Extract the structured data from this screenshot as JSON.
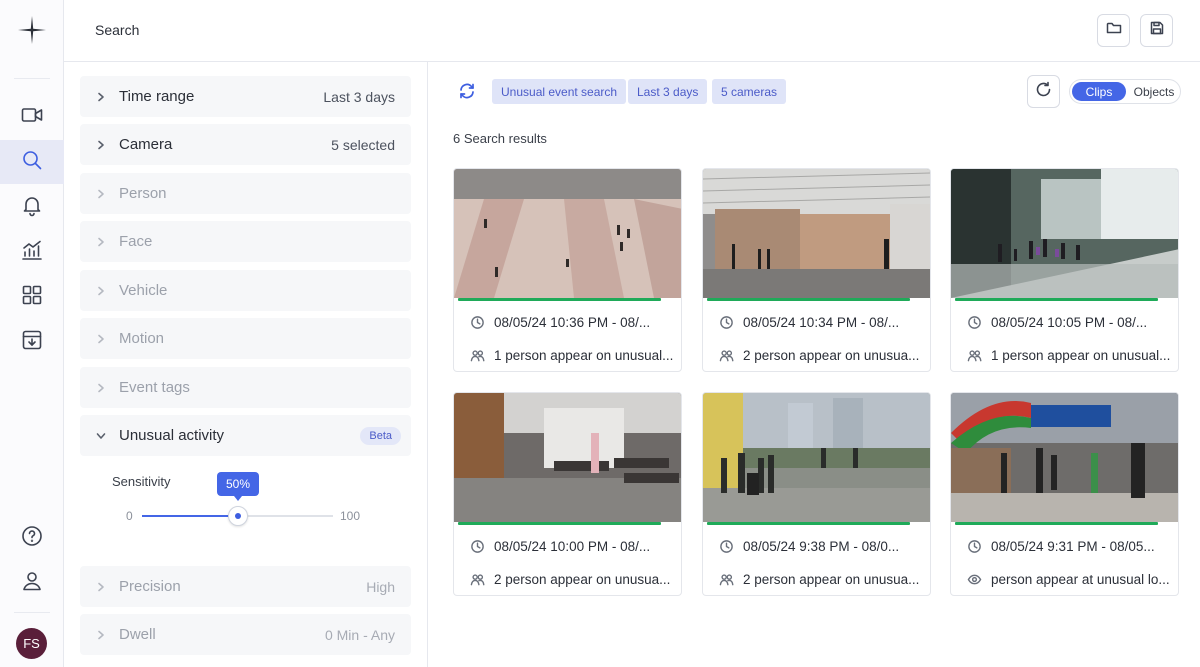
{
  "app": {
    "page_title": "Search",
    "user_initials": "FS"
  },
  "sidebar": {
    "items": [
      {
        "icon": "video-camera-icon",
        "active": false
      },
      {
        "icon": "search-icon",
        "active": true
      },
      {
        "icon": "bell-icon",
        "active": false
      },
      {
        "icon": "analytics-icon",
        "active": false
      },
      {
        "icon": "grid-icon",
        "active": false
      },
      {
        "icon": "download-icon",
        "active": false
      }
    ],
    "bottom": [
      {
        "icon": "help-icon"
      },
      {
        "icon": "user-icon"
      }
    ]
  },
  "toolbar": {
    "folder_icon": "folder-icon",
    "save_icon": "save-icon"
  },
  "filters": {
    "time_range": {
      "label": "Time range",
      "value": "Last 3 days"
    },
    "camera": {
      "label": "Camera",
      "value": "5 selected"
    },
    "person": {
      "label": "Person"
    },
    "face": {
      "label": "Face"
    },
    "vehicle": {
      "label": "Vehicle"
    },
    "motion": {
      "label": "Motion"
    },
    "event_tags": {
      "label": "Event tags"
    },
    "unusual_activity": {
      "label": "Unusual activity",
      "badge": "Beta",
      "sensitivity_label": "Sensitivity",
      "sensitivity_value": 50,
      "sensitivity_text": "50%",
      "min": "0",
      "max": "100"
    },
    "precision": {
      "label": "Precision",
      "value": "High"
    },
    "dwell": {
      "label": "Dwell",
      "value": "0 Min - Any"
    }
  },
  "results": {
    "chips": [
      "Unusual event search",
      "Last 3 days",
      "5 cameras"
    ],
    "view_toggle": {
      "clips": "Clips",
      "objects": "Objects",
      "selected": "Clips"
    },
    "count_text": "6 Search results",
    "items": [
      {
        "time": "08/05/24 10:36 PM  - 08/...",
        "desc": "1 person appear on unusual...",
        "desc_icon": "people-icon"
      },
      {
        "time": "08/05/24 10:34 PM  - 08/...",
        "desc": "2 person appear on unusua...",
        "desc_icon": "people-icon"
      },
      {
        "time": "08/05/24 10:05 PM  - 08/...",
        "desc": "1 person appear on unusual...",
        "desc_icon": "people-icon"
      },
      {
        "time": "08/05/24 10:00 PM  - 08/...",
        "desc": "2 person appear on unusua...",
        "desc_icon": "people-icon"
      },
      {
        "time": "08/05/24 9:38 PM  - 08/0...",
        "desc": "2 person appear on unusua...",
        "desc_icon": "people-icon"
      },
      {
        "time": "08/05/24 9:31 PM  - 08/05...",
        "desc": "person appear at unusual lo...",
        "desc_icon": "eye-icon"
      }
    ]
  }
}
